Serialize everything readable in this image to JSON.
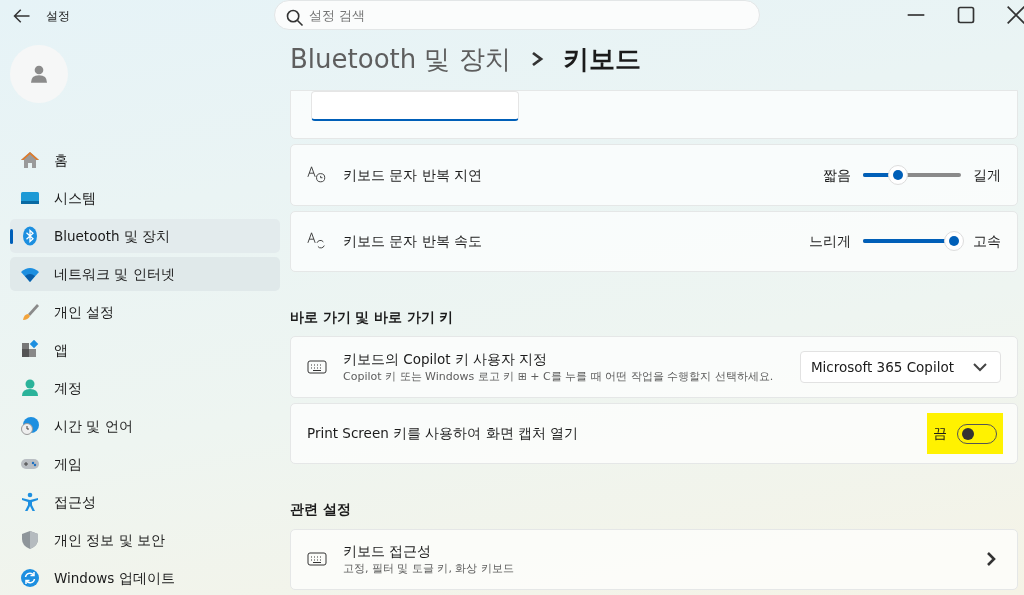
{
  "app": {
    "title": "설정"
  },
  "search": {
    "placeholder": "설정 검색"
  },
  "sidebar": {
    "items": [
      {
        "label": "홈",
        "selected": false,
        "hovered": false
      },
      {
        "label": "시스템",
        "selected": false,
        "hovered": false
      },
      {
        "label": "Bluetooth 및 장치",
        "selected": true,
        "hovered": false
      },
      {
        "label": "네트워크 및 인터넷",
        "selected": false,
        "hovered": true
      },
      {
        "label": "개인 설정",
        "selected": false,
        "hovered": false
      },
      {
        "label": "앱",
        "selected": false,
        "hovered": false
      },
      {
        "label": "계정",
        "selected": false,
        "hovered": false
      },
      {
        "label": "시간 및 언어",
        "selected": false,
        "hovered": false
      },
      {
        "label": "게임",
        "selected": false,
        "hovered": false
      },
      {
        "label": "접근성",
        "selected": false,
        "hovered": false
      },
      {
        "label": "개인 정보 및 보안",
        "selected": false,
        "hovered": false
      },
      {
        "label": "Windows 업데이트",
        "selected": false,
        "hovered": false
      }
    ]
  },
  "breadcrumb": [
    {
      "label": "Bluetooth 및 장치",
      "current": false
    },
    {
      "label": "키보드",
      "current": true
    }
  ],
  "sections": [
    {
      "cards": [
        {
          "kind": "input"
        },
        {
          "kind": "slider",
          "title": "키보드 문자 반복 지연",
          "min_label": "짧음",
          "max_label": "길게",
          "level": 0.36
        },
        {
          "kind": "slider",
          "title": "키보드 문자 반복 속도",
          "min_label": "느리게",
          "max_label": "고속",
          "level": 0.93
        }
      ]
    },
    {
      "heading": "바로 가기 및 바로 가기 키",
      "cards": [
        {
          "kind": "dropdown",
          "title": "키보드의 Copilot 키 사용자 지정",
          "description": "Copilot 키 또는 Windows 로고 키 ⊞ + C를 누를 때 어떤 작업을 수행할지 선택하세요.",
          "value": "Microsoft 365 Copilot"
        },
        {
          "kind": "toggle",
          "title": "Print Screen 키를 사용하여 화면 캡처 열기",
          "state_label": "끔",
          "on": false,
          "highlighted": true
        }
      ]
    },
    {
      "heading": "관련 설정",
      "cards": [
        {
          "kind": "link",
          "title": "키보드 접근성",
          "description": "고정, 필터 및 토글 키, 화상 키보드"
        }
      ]
    }
  ]
}
